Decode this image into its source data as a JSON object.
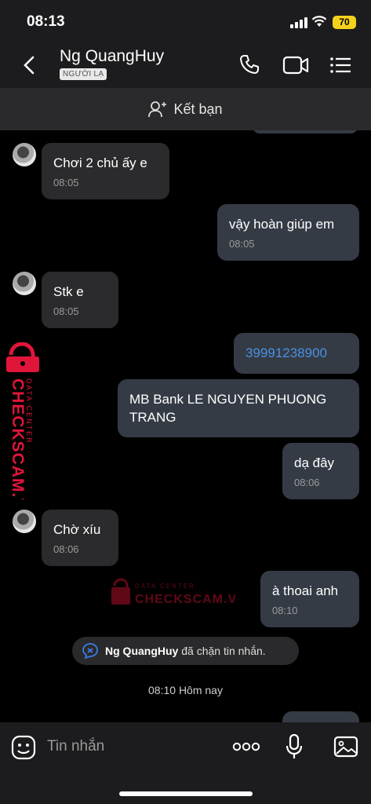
{
  "status": {
    "time": "08:13",
    "battery": "70"
  },
  "header": {
    "name": "Ng QuangHuy",
    "tag": "NGƯỜI LẠ",
    "add_friend": "Kết bạn"
  },
  "messages": [
    {
      "text": "Chơi 2 chủ ấy e",
      "time": "08:05"
    },
    {
      "text": "vậy hoàn giúp em",
      "time": "08:05"
    },
    {
      "text": "Stk e",
      "time": "08:05"
    },
    {
      "text": "39991238900"
    },
    {
      "text": "MB Bank LE NGUYEN PHUONG TRANG"
    },
    {
      "text": "dạ đây",
      "time": "08:06"
    },
    {
      "text": "Chờ xíu",
      "time": "08:06"
    },
    {
      "text": "à thoai anh",
      "time": "08:10"
    }
  ],
  "notice": {
    "name": "Ng QuangHuy",
    "text": "đã chặn tin nhắn."
  },
  "date_separator": "08:10 Hôm nay",
  "watermark": {
    "line1": "DATA CENTER",
    "line2": "CHECKSCAM.VN"
  },
  "composer": {
    "placeholder": "Tin nhắn",
    "more": "ooo"
  },
  "colors": {
    "accent_link": "#4a90e2",
    "incoming": "#2b2b2d",
    "outgoing": "#353b45",
    "watermark": "#e0153a"
  }
}
